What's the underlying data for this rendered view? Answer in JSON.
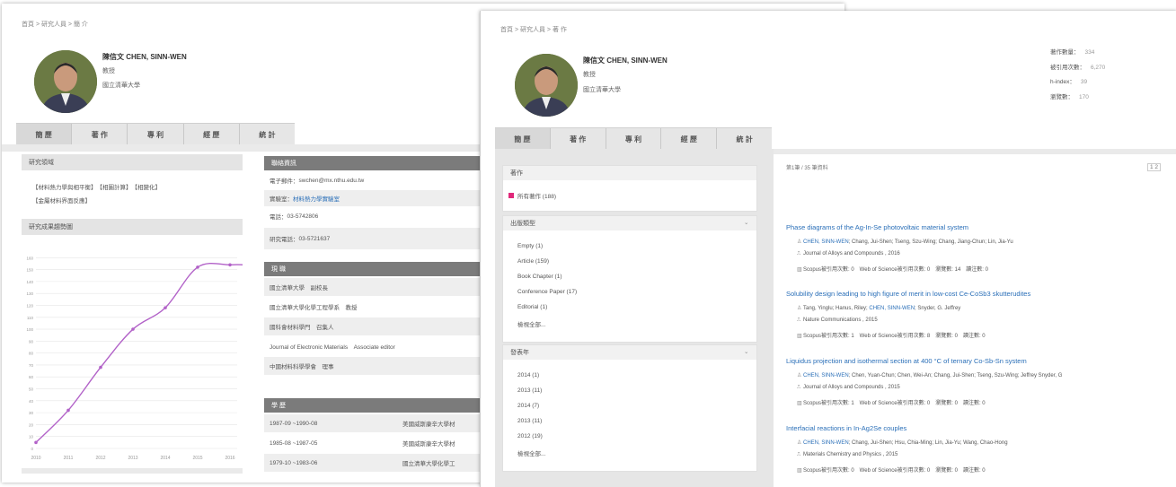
{
  "colors": {
    "accent": "#2a6fb8",
    "line": "#b262c8",
    "pink": "#e0287a",
    "dark_header": "#7b7b7b"
  },
  "left": {
    "breadcrumb": "首頁 > 研究人員 > 簡 介",
    "profile": {
      "name": "陳信文 CHEN, SINN-WEN",
      "title": "教授",
      "org": "國立清華大學"
    },
    "tabs": [
      "簡 歷",
      "著 作",
      "專 利",
      "經 歷",
      "統 計"
    ],
    "research_panel": {
      "header": "研究領域",
      "lines": [
        "【材料熱力學與相平衡】　【相圖計算】　【相變化】",
        "【金屬材料界面反應】"
      ]
    },
    "chart_panel": {
      "header": "研究成果趨勢圖"
    },
    "contact": {
      "header": "聯絡資訊",
      "rows": [
        {
          "label": "電子郵件：",
          "value": "swchen@mx.nthu.edu.tw"
        },
        {
          "label": "實驗室：",
          "value": "材料熱力學實驗室",
          "link": true
        },
        {
          "label": "電話：",
          "value": "03-5742806"
        },
        {
          "label": "研究電話：",
          "value": "03-5721637"
        }
      ]
    },
    "positions": {
      "header": "現 職",
      "rows": [
        "國立清華大學　副校長",
        "國立清華大學化學工程學系　教授",
        "國科會材料學門　召集人",
        "Journal of Electronic Materials　Associate editor",
        "中國材料科學學會　理事"
      ]
    },
    "education": {
      "header": "學 歷",
      "rows": [
        {
          "period": "1987-09 ~1990-08",
          "school": "美國威斯康辛大學材"
        },
        {
          "period": "1985-08 ~1987-05",
          "school": "美國威斯康辛大學材"
        },
        {
          "period": "1979-10 ~1983-06",
          "school": "國立清華大學化學工"
        }
      ]
    }
  },
  "chart_data": {
    "type": "line",
    "categories": [
      "2010",
      "2011",
      "2012",
      "2013",
      "2014",
      "2015",
      "2016"
    ],
    "series": [
      {
        "values": [
          5,
          32,
          68,
          100,
          118,
          152,
          154
        ]
      }
    ],
    "x": [
      2010,
      2011,
      2012,
      2013,
      2014,
      2015,
      2016,
      2016.5
    ],
    "y": [
      5,
      32,
      68,
      100,
      118,
      152,
      154,
      154
    ],
    "ylim": [
      0,
      170
    ],
    "yticks": [
      "0",
      "10",
      "20",
      "30",
      "40",
      "50",
      "60",
      "70",
      "80",
      "90",
      "100",
      "110",
      "120",
      "130",
      "140",
      "150",
      "160"
    ],
    "grid": true,
    "title": "",
    "xlabel": "",
    "ylabel": ""
  },
  "right": {
    "breadcrumb": "首頁 > 研究人員 > 著 作",
    "profile": {
      "name": "陳信文 CHEN, SINN-WEN",
      "title": "教授",
      "org": "國立清華大學"
    },
    "stats": [
      {
        "label": "著作數量：",
        "value": "334"
      },
      {
        "label": "被引用次數：",
        "value": "6,270"
      },
      {
        "label": "h-index：",
        "value": "39"
      },
      {
        "label": "瀏覽數：",
        "value": "170"
      }
    ],
    "tabs": [
      "簡 歷",
      "著 作",
      "專 利",
      "經 歷",
      "統 計"
    ],
    "facet_top": {
      "header": "著作",
      "item": "所有著作 (188)"
    },
    "facet_type": {
      "header": "出版類型",
      "items": [
        "Empty (1)",
        "Article (159)",
        "Book Chapter (1)",
        "Conference Paper (17)",
        "Editorial (1)"
      ],
      "more": "檢視全部..."
    },
    "facet_year": {
      "header": "發表年",
      "items": [
        "2014 (1)",
        "2013 (11)",
        "2014 (7)",
        "2013 (11)",
        "2012 (19)"
      ],
      "more": "檢視全部..."
    },
    "result_header": "第1筆 / 35 筆資料",
    "pager": "1  2",
    "papers": [
      {
        "title": "Phase diagrams of the Ag-In-Se photovoltaic material system",
        "author_link": "CHEN, SINN-WEN",
        "authors": "; Chang, Jui-Shen; Tseng, Szu-Wing; Chang, Jiang-Chun; Lin, Jia-Yu",
        "journal": "Journal of Alloys and Compounds , 2016",
        "metrics": "Scopus被引用次數: 0　Web of Science被引用次數: 0　瀏覽數: 14　讀注數: 0"
      },
      {
        "title": "Solubility design leading to high figure of merit in low-cost Ce-CoSb3 skutterudites",
        "author_link": "CHEN, SINN-WEN",
        "authors_pre": "Tang, Yinglu; Hanus, Riley; ",
        "authors": "; Snyder, G. Jeffrey",
        "journal": "Nature Communications , 2015",
        "metrics": "Scopus被引用次數: 1　Web of Science被引用次數: 8　瀏覽數: 0　讀注數: 0"
      },
      {
        "title": "Liquidus projection and isothermal section at 400 °C of ternary Co-Sb-Sn system",
        "author_link": "CHEN, SINN-WEN",
        "authors": "; Chen, Yuan-Chun; Chen, Wei-An; Chang, Jui-Shen; Tseng, Szu-Wing; Jeffrey Snyder, G",
        "journal": "Journal of Alloys and Compounds , 2015",
        "metrics": "Scopus被引用次數: 1　Web of Science被引用次數: 0　瀏覽數: 0　讀注數: 0"
      },
      {
        "title": "Interfacial reactions in In-Ag2Se couples",
        "author_link": "CHEN, SINN-WEN",
        "authors": "; Chang, Jui-Shen; Hsu, Chia-Ming; Lin, Jia-Yu; Wang, Chao-Hong",
        "journal": "Materials Chemistry and Physics , 2015",
        "metrics": "Scopus被引用次數: 0　Web of Science被引用次數: 0　瀏覽數: 0　讀注數: 0"
      }
    ]
  }
}
